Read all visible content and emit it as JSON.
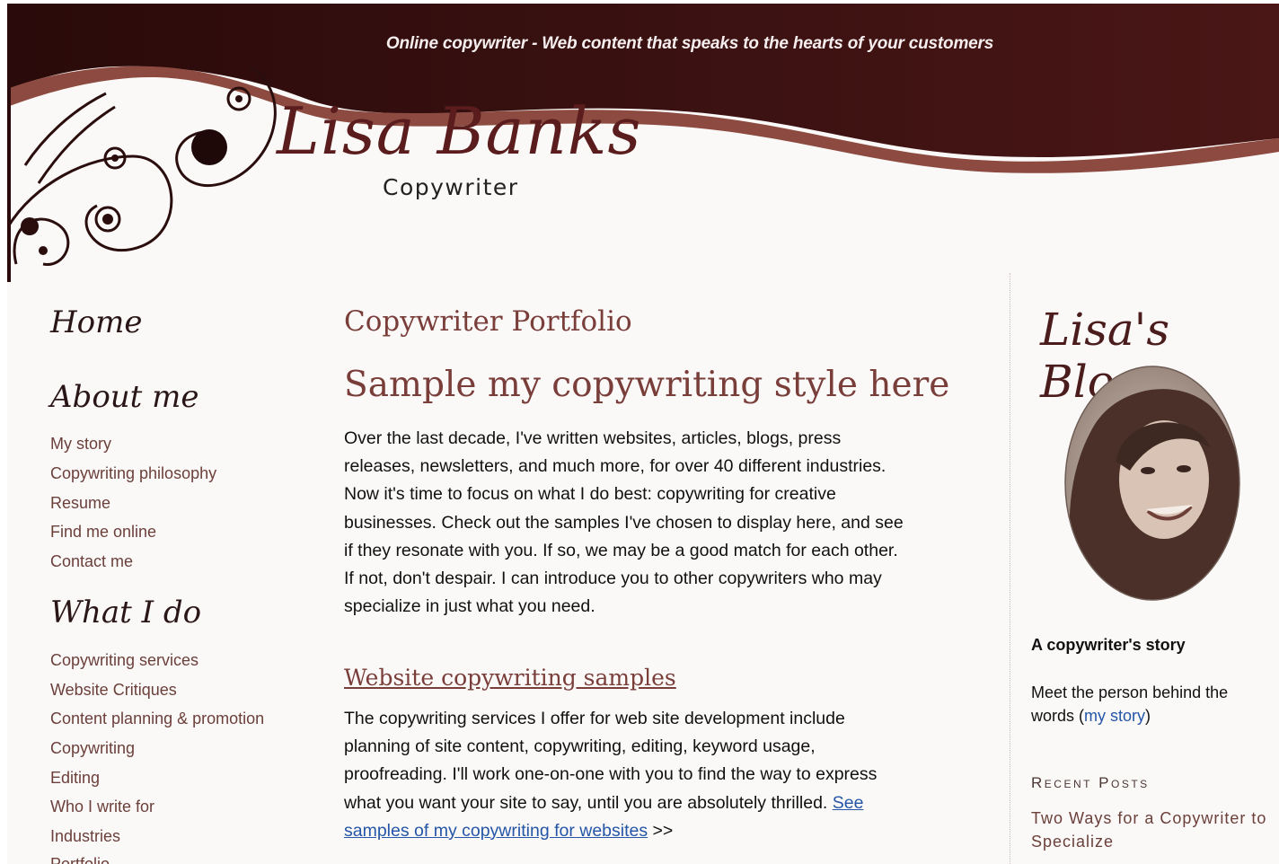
{
  "header": {
    "tagline": "Online copywriter - Web content that speaks to the hearts of your customers",
    "logo_name": "Lisa Banks",
    "logo_sub": "Copywriter"
  },
  "nav": {
    "home": "Home",
    "about_heading": "About me",
    "about_links": [
      "My story",
      "Copywriting philosophy",
      "Resume",
      "Find me online",
      "Contact me"
    ],
    "do_heading": "What I do",
    "do_links": [
      "Copywriting services",
      "Website Critiques",
      "Content planning & promotion",
      "Copywriting",
      "Editing",
      "Who I write for",
      "Industries",
      "Portfolio"
    ]
  },
  "main": {
    "title": "Copywriter Portfolio",
    "subtitle": "Sample my copywriting style here",
    "intro_lines": [
      "Over the last decade, I've written websites, articles, blogs, press",
      "releases, newsletters, and much more, for over 40 different industries.",
      "Now it's time to focus on what I do best: copywriting for creative",
      "businesses. Check out the samples I've chosen to display here, and see",
      "if they resonate with you. If so, we may be a good match for each other.",
      "If not, don't despair. I can introduce you to other copywriters who may",
      "specialize in just what you need."
    ],
    "section_title": "Website copywriting samples",
    "section_lines": [
      "The copywriting services I offer for web site development include",
      "planning of site content, copywriting, editing, keyword usage,",
      "proofreading. I'll work one-on-one with you to find the way to express"
    ],
    "section_last_text": "what you want your site to say, until you are absolutely thrilled. ",
    "section_link_part1": "See",
    "section_link_part2": "samples of my copywriting for websites",
    "section_arrows": " >>"
  },
  "sidebar": {
    "blog_title": "Lisa's Blog",
    "story_heading": "A copywriter's story",
    "story_text": "Meet the person behind the words (",
    "story_link": "my story",
    "story_close": ")",
    "recent_heading": "Recent Posts",
    "recent_post": "Two Ways for a Copywriter to Specialize"
  },
  "colors": {
    "header_dark": "#3a0f0f",
    "accent": "#7a3e3a",
    "link": "#2455a6",
    "nav_link": "#6b3f3a"
  }
}
